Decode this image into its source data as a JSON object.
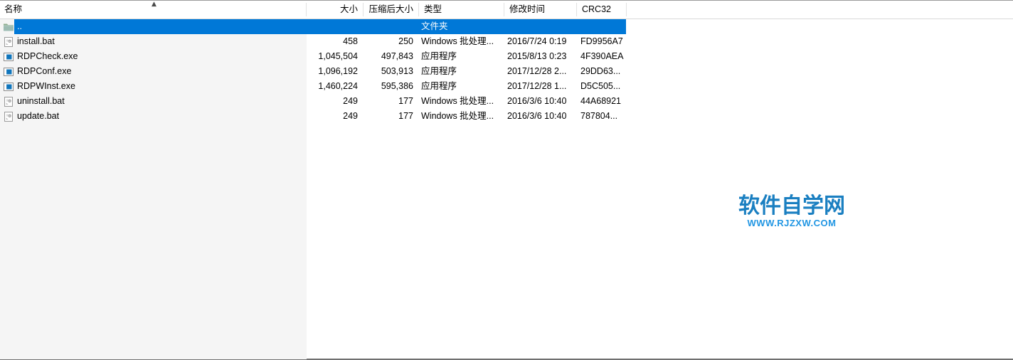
{
  "window": {
    "selection_color": "#0078d7",
    "header_text_color": "#000000"
  },
  "header": {
    "sort_indicator": "▲",
    "columns": [
      {
        "key": "name",
        "label": "名称"
      },
      {
        "key": "size",
        "label": "大小"
      },
      {
        "key": "packed",
        "label": "压缩后大小"
      },
      {
        "key": "type",
        "label": "类型"
      },
      {
        "key": "modified",
        "label": "修改时间"
      },
      {
        "key": "crc",
        "label": "CRC32"
      }
    ]
  },
  "rows": [
    {
      "name": "..",
      "icon": "folder-icon",
      "size": "",
      "packed": "",
      "type": "文件夹",
      "modified": "",
      "crc": "",
      "selected": true
    },
    {
      "name": "install.bat",
      "icon": "batch-file-icon",
      "size": "458",
      "packed": "250",
      "type": "Windows 批处理...",
      "modified": "2016/7/24 0:19",
      "crc": "FD9956A7",
      "selected": false
    },
    {
      "name": "RDPCheck.exe",
      "icon": "application-icon",
      "size": "1,045,504",
      "packed": "497,843",
      "type": "应用程序",
      "modified": "2015/8/13 0:23",
      "crc": "4F390AEA",
      "selected": false
    },
    {
      "name": "RDPConf.exe",
      "icon": "application-icon",
      "size": "1,096,192",
      "packed": "503,913",
      "type": "应用程序",
      "modified": "2017/12/28 2...",
      "crc": "29DD63...",
      "selected": false
    },
    {
      "name": "RDPWInst.exe",
      "icon": "application-icon",
      "size": "1,460,224",
      "packed": "595,386",
      "type": "应用程序",
      "modified": "2017/12/28 1...",
      "crc": "D5C505...",
      "selected": false
    },
    {
      "name": "uninstall.bat",
      "icon": "batch-file-icon",
      "size": "249",
      "packed": "177",
      "type": "Windows 批处理...",
      "modified": "2016/3/6 10:40",
      "crc": "44A68921",
      "selected": false
    },
    {
      "name": "update.bat",
      "icon": "batch-file-icon",
      "size": "249",
      "packed": "177",
      "type": "Windows 批处理...",
      "modified": "2016/3/6 10:40",
      "crc": "787804...",
      "selected": false
    }
  ],
  "watermark": {
    "title": "软件自学网",
    "url": "WWW.RJZXW.COM",
    "title_color": "#1a7fc1",
    "url_color": "#2196e3"
  }
}
